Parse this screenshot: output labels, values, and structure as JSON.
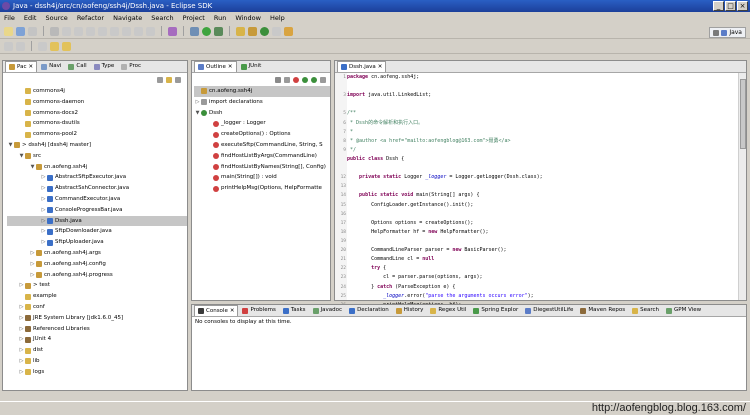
{
  "window": {
    "title": "Java - dssh4j/src/cn/aofeng/ssh4j/Dssh.java - Eclipse SDK",
    "controls": [
      "_",
      "□",
      "×"
    ]
  },
  "menu": [
    "File",
    "Edit",
    "Source",
    "Refactor",
    "Navigate",
    "Search",
    "Project",
    "Run",
    "Window",
    "Help"
  ],
  "perspective": {
    "label": "Java"
  },
  "left_tabs": [
    "Pac",
    "Navi",
    "Call",
    "Type",
    "Proc"
  ],
  "package_tree": [
    {
      "label": "commons4j",
      "depth": 1,
      "twisty": "",
      "icon": "folder"
    },
    {
      "label": "commons-daemon",
      "depth": 1,
      "twisty": "",
      "icon": "folder"
    },
    {
      "label": "commons-docs2",
      "depth": 1,
      "twisty": "",
      "icon": "folder"
    },
    {
      "label": "commons-dsutils",
      "depth": 1,
      "twisty": "",
      "icon": "folder"
    },
    {
      "label": "commons-pool2",
      "depth": 1,
      "twisty": "",
      "icon": "folder"
    },
    {
      "label": "> dssh4j [dssh4j master]",
      "depth": 0,
      "twisty": "▼",
      "icon": "project"
    },
    {
      "label": "src",
      "depth": 1,
      "twisty": "▼",
      "icon": "src"
    },
    {
      "label": "cn.aofeng.ssh4j",
      "depth": 2,
      "twisty": "▼",
      "icon": "package"
    },
    {
      "label": "AbstractSftpExecutor.java",
      "depth": 3,
      "twisty": "▷",
      "icon": "java"
    },
    {
      "label": "AbstractSshConnector.java",
      "depth": 3,
      "twisty": "▷",
      "icon": "java"
    },
    {
      "label": "CommandExecutor.java",
      "depth": 3,
      "twisty": "▷",
      "icon": "java"
    },
    {
      "label": "ConsoleProgressBar.java",
      "depth": 3,
      "twisty": "▷",
      "icon": "java"
    },
    {
      "label": "Dssh.java",
      "depth": 3,
      "twisty": "▷",
      "icon": "java",
      "selected": true
    },
    {
      "label": "SftpDownloader.java",
      "depth": 3,
      "twisty": "▷",
      "icon": "java"
    },
    {
      "label": "SftpUploader.java",
      "depth": 3,
      "twisty": "▷",
      "icon": "java"
    },
    {
      "label": "cn.aofeng.ssh4j.args",
      "depth": 2,
      "twisty": "▷",
      "icon": "package"
    },
    {
      "label": "cn.aofeng.ssh4j.config",
      "depth": 2,
      "twisty": "▷",
      "icon": "package"
    },
    {
      "label": "cn.aofeng.ssh4j.progress",
      "depth": 2,
      "twisty": "▷",
      "icon": "package"
    },
    {
      "label": "> test",
      "depth": 1,
      "twisty": "▷",
      "icon": "src"
    },
    {
      "label": "example",
      "depth": 1,
      "twisty": "",
      "icon": "folder"
    },
    {
      "label": "conf",
      "depth": 1,
      "twisty": "▷",
      "icon": "folder"
    },
    {
      "label": "JRE System Library [jdk1.6.0_45]",
      "depth": 1,
      "twisty": "▷",
      "icon": "lib"
    },
    {
      "label": "Referenced Libraries",
      "depth": 1,
      "twisty": "▷",
      "icon": "lib"
    },
    {
      "label": "JUnit 4",
      "depth": 1,
      "twisty": "▷",
      "icon": "lib"
    },
    {
      "label": "dist",
      "depth": 1,
      "twisty": "▷",
      "icon": "folder"
    },
    {
      "label": "lib",
      "depth": 1,
      "twisty": "▷",
      "icon": "folder"
    },
    {
      "label": "logs",
      "depth": 1,
      "twisty": "▷",
      "icon": "folder"
    }
  ],
  "outline_tabs": [
    "Outline",
    "JUnit"
  ],
  "outline": [
    {
      "label": "cn.aofeng.ssh4j",
      "depth": 0,
      "twisty": "",
      "icon": "package",
      "selected": true
    },
    {
      "label": "import declarations",
      "depth": 0,
      "twisty": "▷",
      "icon": "import"
    },
    {
      "label": "Dssh",
      "depth": 0,
      "twisty": "▼",
      "icon": "class"
    },
    {
      "label": "_logger : Logger",
      "depth": 1,
      "twisty": "",
      "icon": "field"
    },
    {
      "label": "createOptions() : Options",
      "depth": 1,
      "twisty": "",
      "icon": "method"
    },
    {
      "label": "executeSftp(CommandLine, String, S",
      "depth": 1,
      "twisty": "",
      "icon": "method"
    },
    {
      "label": "findHostListByArgs(CommandLine)",
      "depth": 1,
      "twisty": "",
      "icon": "method"
    },
    {
      "label": "findHostListByNames(String[], Config)",
      "depth": 1,
      "twisty": "",
      "icon": "method"
    },
    {
      "label": "main(String[]) : void",
      "depth": 1,
      "twisty": "",
      "icon": "method"
    },
    {
      "label": "printHelpMsg(Options, HelpFormatte",
      "depth": 1,
      "twisty": "",
      "icon": "method"
    }
  ],
  "editor_tab": "Dssh.java",
  "line_numbers": [
    "1",
    "",
    "3",
    "",
    "5",
    "6",
    "7",
    "8",
    "9",
    "",
    "",
    "12",
    "13",
    "14",
    "15",
    "16",
    "17",
    "18",
    "19",
    "20",
    "21",
    "22",
    "23",
    "24",
    "25",
    "26",
    "27",
    "28",
    "29",
    "30"
  ],
  "code": [
    [
      [
        "kw",
        "package "
      ],
      [
        "",
        "cn.aofeng.ssh4j;"
      ]
    ],
    [],
    [
      [
        "kw",
        "import "
      ],
      [
        "",
        "java.util.LinkedList;"
      ]
    ],
    [],
    [
      [
        "cm",
        "/**"
      ]
    ],
    [
      [
        "cm",
        " * Dssh的命令解析和执行入口。"
      ]
    ],
    [
      [
        "cm",
        " *"
      ]
    ],
    [
      [
        "cm",
        " * @author <a href=\"mailto:aofengblog@163.com\">聂勇</a>"
      ]
    ],
    [
      [
        "cm",
        " */"
      ]
    ],
    [
      [
        "kw",
        "public class "
      ],
      [
        "",
        "Dssh {"
      ]
    ],
    [],
    [
      [
        "",
        "    "
      ],
      [
        "kw",
        "private static "
      ],
      [
        "",
        "Logger "
      ],
      [
        "fld",
        "_logger"
      ],
      [
        "",
        " = Logger.getLogger(Dssh.class);"
      ]
    ],
    [],
    [
      [
        "",
        "    "
      ],
      [
        "kw",
        "public static void "
      ],
      [
        "",
        "main(String[] args) {"
      ]
    ],
    [
      [
        "",
        "        ConfigLoader.getInstance().init();"
      ]
    ],
    [],
    [
      [
        "",
        "        Options options = createOptions();"
      ]
    ],
    [
      [
        "",
        "        HelpFormatter hf = "
      ],
      [
        "kw",
        "new "
      ],
      [
        "",
        "HelpFormatter();"
      ]
    ],
    [],
    [
      [
        "",
        "        CommandLineParser parser = "
      ],
      [
        "kw",
        "new "
      ],
      [
        "",
        "BasicParser();"
      ]
    ],
    [
      [
        "",
        "        CommandLine cl = "
      ],
      [
        "kw",
        "null"
      ],
      [
        ";"
      ]
    ],
    [
      [
        "",
        "        "
      ],
      [
        "kw",
        "try "
      ],
      [
        "",
        "{"
      ]
    ],
    [
      [
        "",
        "            cl = parser.parse(options, args);"
      ]
    ],
    [
      [
        "",
        "        } "
      ],
      [
        "kw",
        "catch "
      ],
      [
        "",
        "(ParseException e) {"
      ]
    ],
    [
      [
        "",
        "            "
      ],
      [
        "fld",
        "_logger"
      ],
      [
        "",
        ".error("
      ],
      [
        "str",
        "\"parse the arguments occurs error\""
      ],
      [
        "",
        ");"
      ]
    ],
    [
      [
        "",
        "            printHelpMsg(options, hf);"
      ]
    ],
    [
      [
        "",
        "            "
      ],
      [
        "kw",
        "return"
      ],
      [
        ";"
      ]
    ],
    [
      [
        "",
        "        }"
      ]
    ],
    [],
    [
      [
        "",
        "        Config config = ConfigLoader.getInstance().getConfig();"
      ]
    ]
  ],
  "bottom_tabs": [
    "Console",
    "Problems",
    "Tasks",
    "Javadoc",
    "Declaration",
    "History",
    "Regex Util",
    "Spring Explor",
    "DiegestUtilLife",
    "Maven Repos",
    "Search",
    "GPM View"
  ],
  "console_message": "No consoles to display at this time.",
  "watermark": "http://aofengblog.blog.163.com/",
  "colors": {
    "title_bar": "#1c3f9a",
    "chrome": "#d4d0c8",
    "keyword": "#7f0055",
    "comment": "#3f7f5f",
    "string": "#2a00ff",
    "field": "#0000c0"
  }
}
